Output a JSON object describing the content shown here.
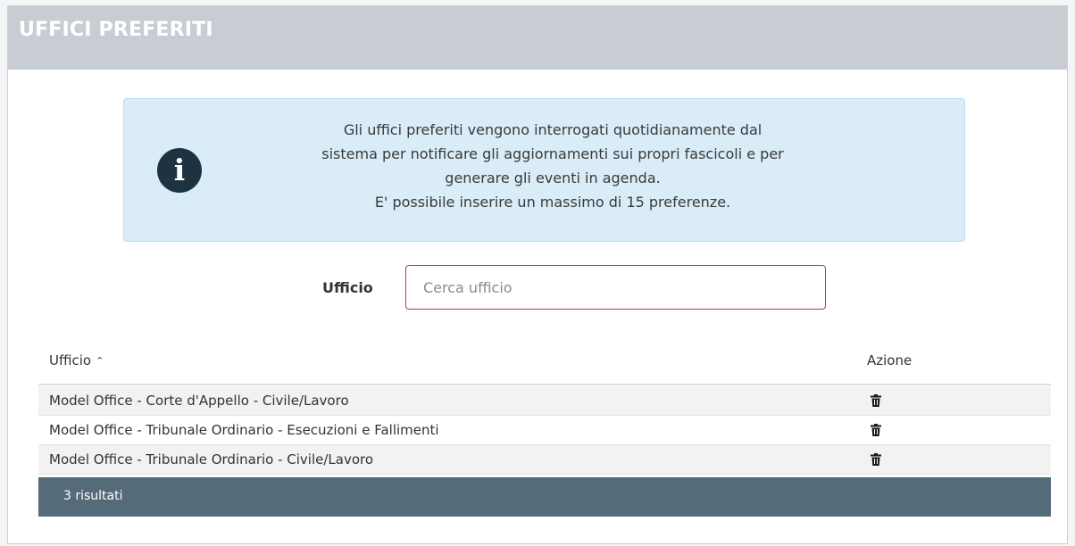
{
  "header": {
    "title": "UFFICI PREFERITI"
  },
  "info": {
    "icon": "info-circle-icon",
    "lines": [
      "Gli uffici preferiti vengono interrogati quotidianamente dal",
      "sistema per notificare gli aggiornamenti sui propri fascicoli e per",
      "generare gli eventi in agenda.",
      "E' possibile inserire un massimo di 15 preferenze."
    ]
  },
  "search": {
    "label": "Ufficio",
    "placeholder": "Cerca ufficio",
    "value": ""
  },
  "table": {
    "columns": [
      "Ufficio",
      "Azione"
    ],
    "sort_icon": "chevron-up-icon",
    "rows": [
      {
        "name": "Model Office - Corte d'Appello - Civile/Lavoro",
        "action_icon": "trash-icon"
      },
      {
        "name": "Model Office - Tribunale Ordinario - Esecuzioni e Fallimenti",
        "action_icon": "trash-icon"
      },
      {
        "name": "Model Office - Tribunale Ordinario - Civile/Lavoro",
        "action_icon": "trash-icon"
      }
    ],
    "footer": "3 risultati"
  },
  "colors": {
    "header_bg": "#c8cdd4",
    "alert_bg": "#d9ecf8",
    "input_border": "#b43b3b",
    "footer_bg": "#546b7a"
  }
}
